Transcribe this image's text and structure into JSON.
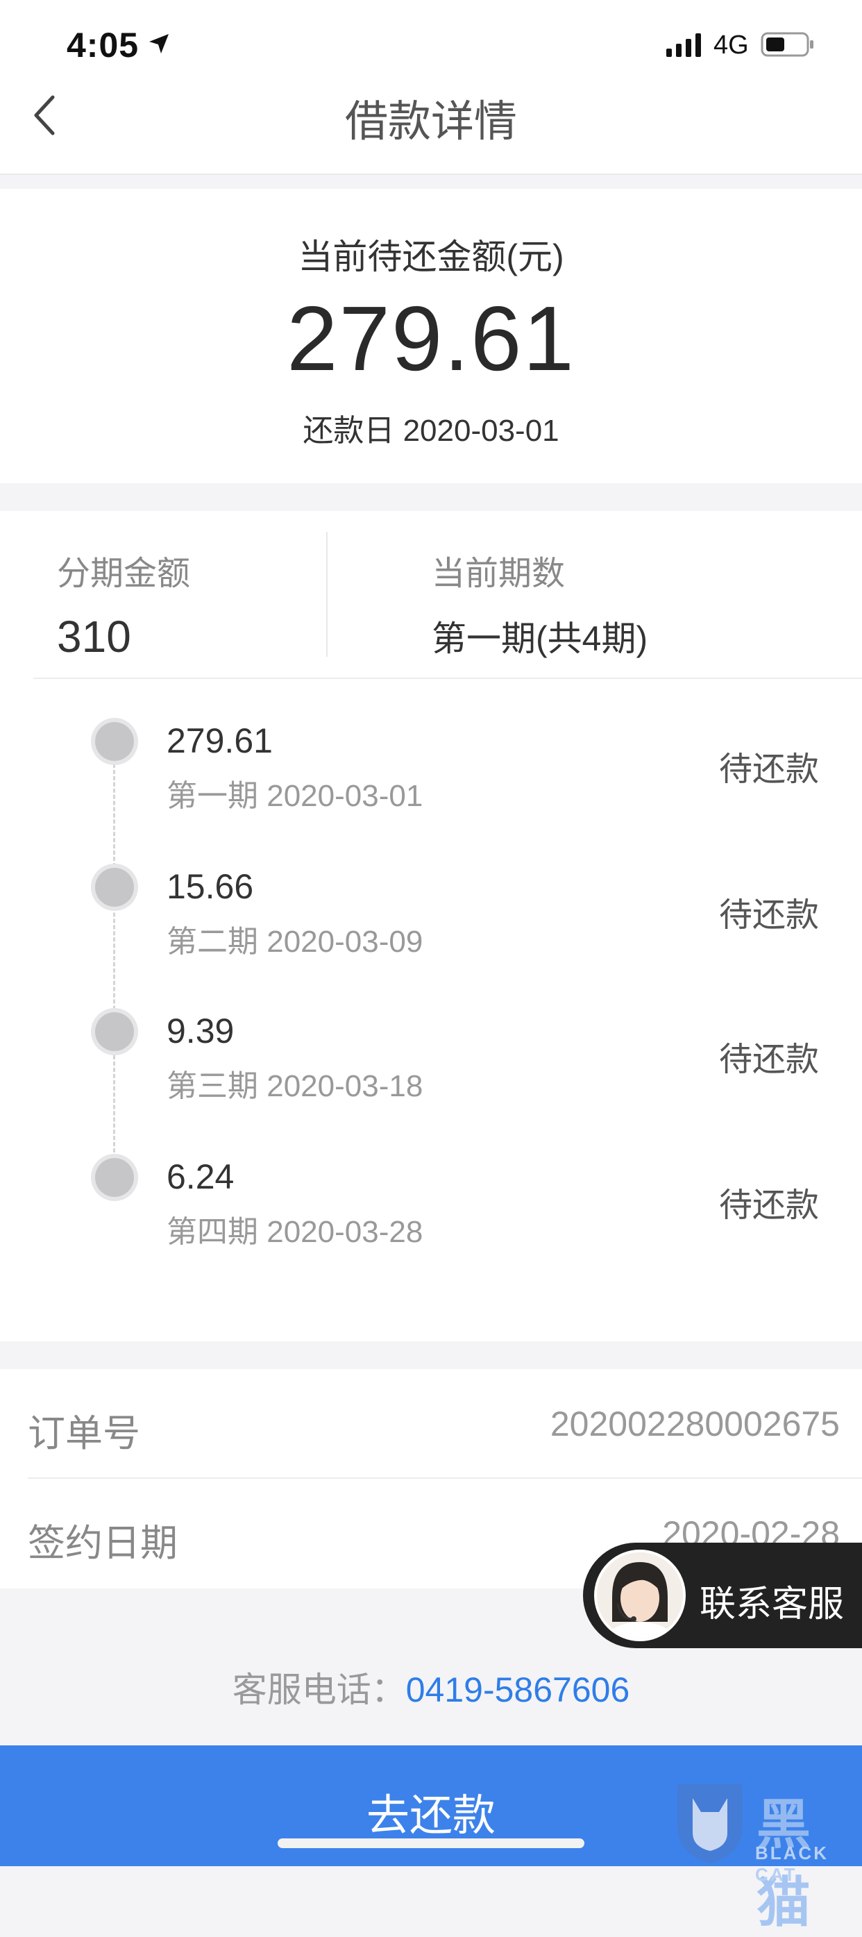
{
  "status_bar": {
    "time": "4:05",
    "network": "4G"
  },
  "nav": {
    "title": "借款详情"
  },
  "summary": {
    "label": "当前待还金额(元)",
    "amount": "279.61",
    "due_date": "还款日 2020-03-01"
  },
  "plan": {
    "installment_amount_label": "分期金额",
    "installment_amount": "310",
    "current_period_label": "当前期数",
    "current_period": "第一期(共4期)",
    "items": [
      {
        "amount": "279.61",
        "sub": "第一期 2020-03-01",
        "status": "待还款"
      },
      {
        "amount": "15.66",
        "sub": "第二期 2020-03-09",
        "status": "待还款"
      },
      {
        "amount": "9.39",
        "sub": "第三期 2020-03-18",
        "status": "待还款"
      },
      {
        "amount": "6.24",
        "sub": "第四期 2020-03-28",
        "status": "待还款"
      }
    ]
  },
  "order": {
    "order_no_label": "订单号",
    "order_no": "202002280002675",
    "sign_date_label": "签约日期",
    "sign_date": "2020-02-28"
  },
  "service": {
    "label": "联系客服"
  },
  "phone": {
    "label": "客服电话：",
    "number": "0419-5867606"
  },
  "repay_button": {
    "label": "去还款"
  },
  "watermark": {
    "text": "黑猫",
    "sub": "BLACK CAT"
  },
  "colors": {
    "accent": "#3c82ea",
    "link": "#2f7de8"
  }
}
